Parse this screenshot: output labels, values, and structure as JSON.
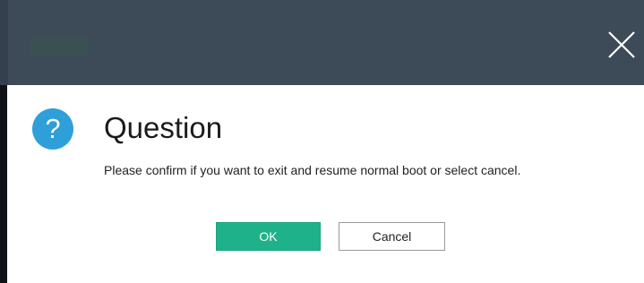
{
  "dialog": {
    "heading": "Question",
    "message": "Please confirm if you want to exit and resume normal boot or select cancel.",
    "icon": "question-icon",
    "icon_glyph": "?",
    "close_icon": "close-icon",
    "buttons": {
      "ok_label": "OK",
      "cancel_label": "Cancel"
    }
  },
  "colors": {
    "titlebar": "#3d4a57",
    "icon_accent": "#2e9fd9",
    "primary_button": "#1fb28a"
  }
}
